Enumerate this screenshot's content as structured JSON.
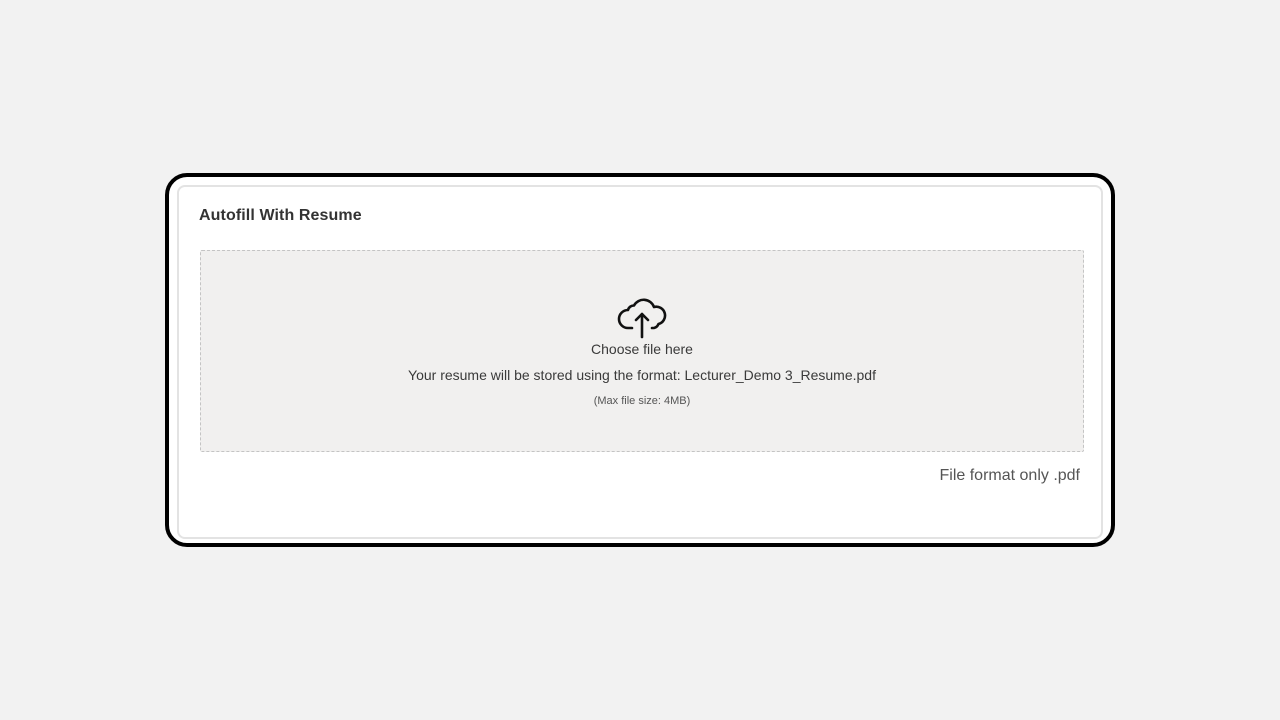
{
  "section": {
    "title": "Autofill With Resume"
  },
  "dropzone": {
    "icon": "cloud-upload-icon",
    "choose_label": "Choose file here",
    "format_message": "Your resume will be stored using the format: Lecturer_Demo 3_Resume.pdf",
    "max_size": "(Max file size: 4MB)"
  },
  "format_note": "File format only .pdf",
  "colors": {
    "page_background": "#f2f2f2",
    "frame_border": "#000000",
    "dropzone_background": "#f1f0ef"
  }
}
